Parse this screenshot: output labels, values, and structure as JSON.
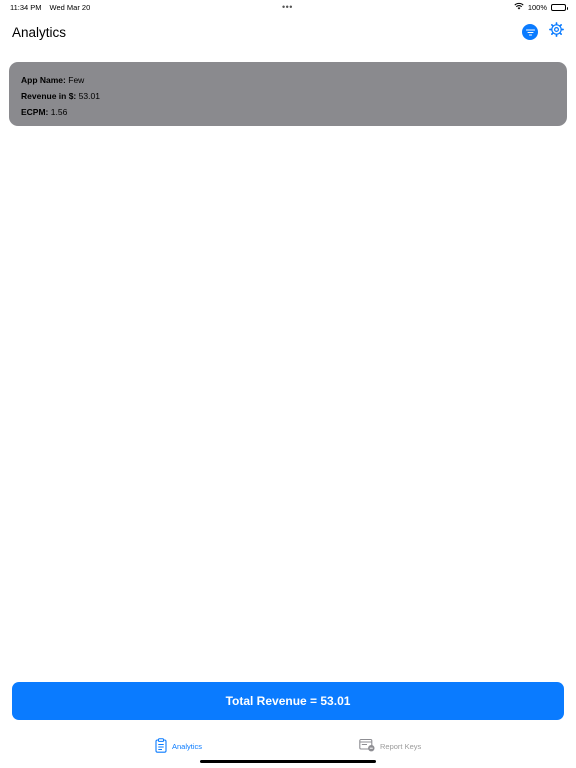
{
  "status_bar": {
    "time": "11:34 PM",
    "date": "Wed Mar 20",
    "dots": "•••",
    "battery_text": "100%",
    "wifi_icon": "wifi-icon",
    "battery_icon": "battery-icon"
  },
  "nav": {
    "title": "Analytics",
    "filter_icon": "filter-icon",
    "settings_icon": "gear-icon"
  },
  "card": {
    "app_name_label": "App Name:",
    "app_name_value": "Few",
    "revenue_label": "Revenue in $:",
    "revenue_value": "53.01",
    "ecpm_label": "ECPM:",
    "ecpm_value": "1.56"
  },
  "total_button": {
    "label": "Total Revenue = 53.01"
  },
  "tabs": [
    {
      "label": "Analytics",
      "icon": "clipboard-icon",
      "selected": true
    },
    {
      "label": "Report Keys",
      "icon": "report-keys-icon",
      "selected": false
    }
  ],
  "colors": {
    "accent": "#0a7bff",
    "card_bg": "#8a8a8e",
    "tab_inactive": "#9b9b9b"
  }
}
